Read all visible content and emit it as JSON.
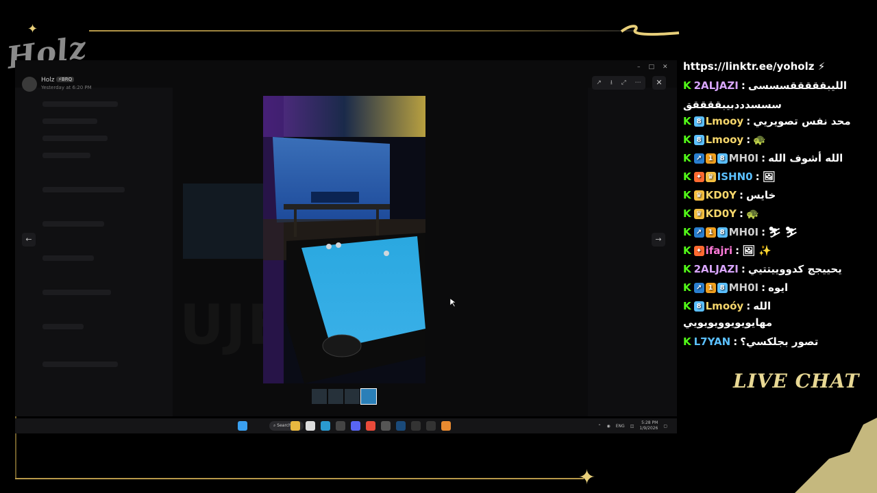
{
  "overlay": {
    "logo_text": "Holz",
    "chat_title": "LIVE CHAT"
  },
  "discord": {
    "author": "Holz",
    "author_badge": "⚡BRQ",
    "timestamp": "Yesterday at 6:20 PM",
    "window_controls": [
      "–",
      "□",
      "✕"
    ],
    "viewer_tools": [
      "↗",
      "⭳",
      "⤢",
      "⋯"
    ],
    "close_label": "✕",
    "prev_label": "←",
    "next_label": "→"
  },
  "taskbar": {
    "search_label": "Search",
    "lang": "ENG",
    "time": "5:28 PM",
    "date": "1/9/2026"
  },
  "chat": {
    "messages": [
      {
        "user": "",
        "color": "#ffffff",
        "text": "https://linktr.ee/yoholz ⚡",
        "badges": [],
        "kick": false
      },
      {
        "user": "2ALJAZI",
        "color": "#d9a6ff",
        "text": "الليبقققققسسسى",
        "badges": [],
        "kick": true
      },
      {
        "user": "",
        "color": "#ffffff",
        "text": "سسسدددبيبققققق",
        "badges": [],
        "kick": false
      },
      {
        "user": "Lmooy",
        "color": "#f5d66b",
        "text": "محد نفس تصويريي",
        "badges": [
          "8"
        ],
        "kick": true
      },
      {
        "user": "Lmooy",
        "color": "#f5d66b",
        "text": "🐢",
        "badges": [
          "8"
        ],
        "kick": true
      },
      {
        "user": "MH0I",
        "color": "#cfcfcf",
        "text": "الله أشوف الله",
        "badges": [
          "↗",
          "1",
          "8"
        ],
        "kick": true
      },
      {
        "user": "ISHN0",
        "color": "#5bc0ff",
        "text": "🖼",
        "badges": [
          "✦",
          "♛"
        ],
        "kick": true
      },
      {
        "user": "KD0Y",
        "color": "#f5d66b",
        "text": "خايس",
        "badges": [
          "♛"
        ],
        "kick": true
      },
      {
        "user": "KD0Y",
        "color": "#f5d66b",
        "text": "🐢",
        "badges": [
          "♛"
        ],
        "kick": true
      },
      {
        "user": "MH0I",
        "color": "#cfcfcf",
        "text": "⛷ ⛷",
        "badges": [
          "↗",
          "1",
          "8"
        ],
        "kick": true
      },
      {
        "user": "ifajri",
        "color": "#ff7ad9",
        "text": "🖼 ✨",
        "badges": [
          "✦"
        ],
        "kick": true
      },
      {
        "user": "2ALJAZI",
        "color": "#d9a6ff",
        "text": "يحييجج كدووييتتيي",
        "badges": [],
        "kick": true
      },
      {
        "user": "MH0I",
        "color": "#cfcfcf",
        "text": "ايوه",
        "badges": [
          "↗",
          "1",
          "8"
        ],
        "kick": true
      },
      {
        "user": "Lmoóy",
        "color": "#f5d66b",
        "text": "الله",
        "badges": [
          "8"
        ],
        "kick": true
      },
      {
        "user": "",
        "color": "#ffffff",
        "text": "مهايويويوويويويي",
        "badges": [],
        "kick": false
      },
      {
        "user": "L7YAN",
        "color": "#5bc0ff",
        "text": "تصور بجلكسي؟",
        "badges": [],
        "kick": true
      }
    ]
  },
  "colors": {
    "gold": "#b89a4a",
    "kick_green": "#53fc18"
  },
  "icons": [
    "close-icon",
    "arrow-left-icon",
    "arrow-right-icon",
    "windows-start-icon",
    "search-icon"
  ]
}
